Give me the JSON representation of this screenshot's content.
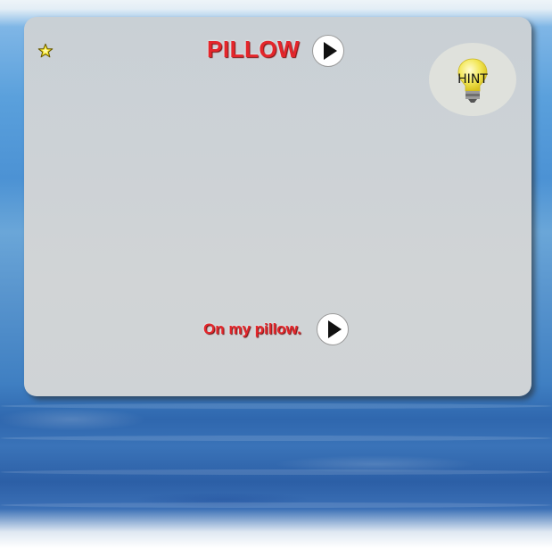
{
  "card": {
    "word": "PILLOW",
    "sentence": "On my pillow.",
    "hint_label": "HINT"
  },
  "icons": {
    "star": "star-icon",
    "play": "play-icon",
    "hint": "lightbulb-icon"
  },
  "colors": {
    "text_red": "#e4262b",
    "panel_gray": "#cdd2d6",
    "star_yellow": "#f5e52a",
    "bulb_yellow": "#f3e85a",
    "sea_blue": "#4c92d4"
  }
}
